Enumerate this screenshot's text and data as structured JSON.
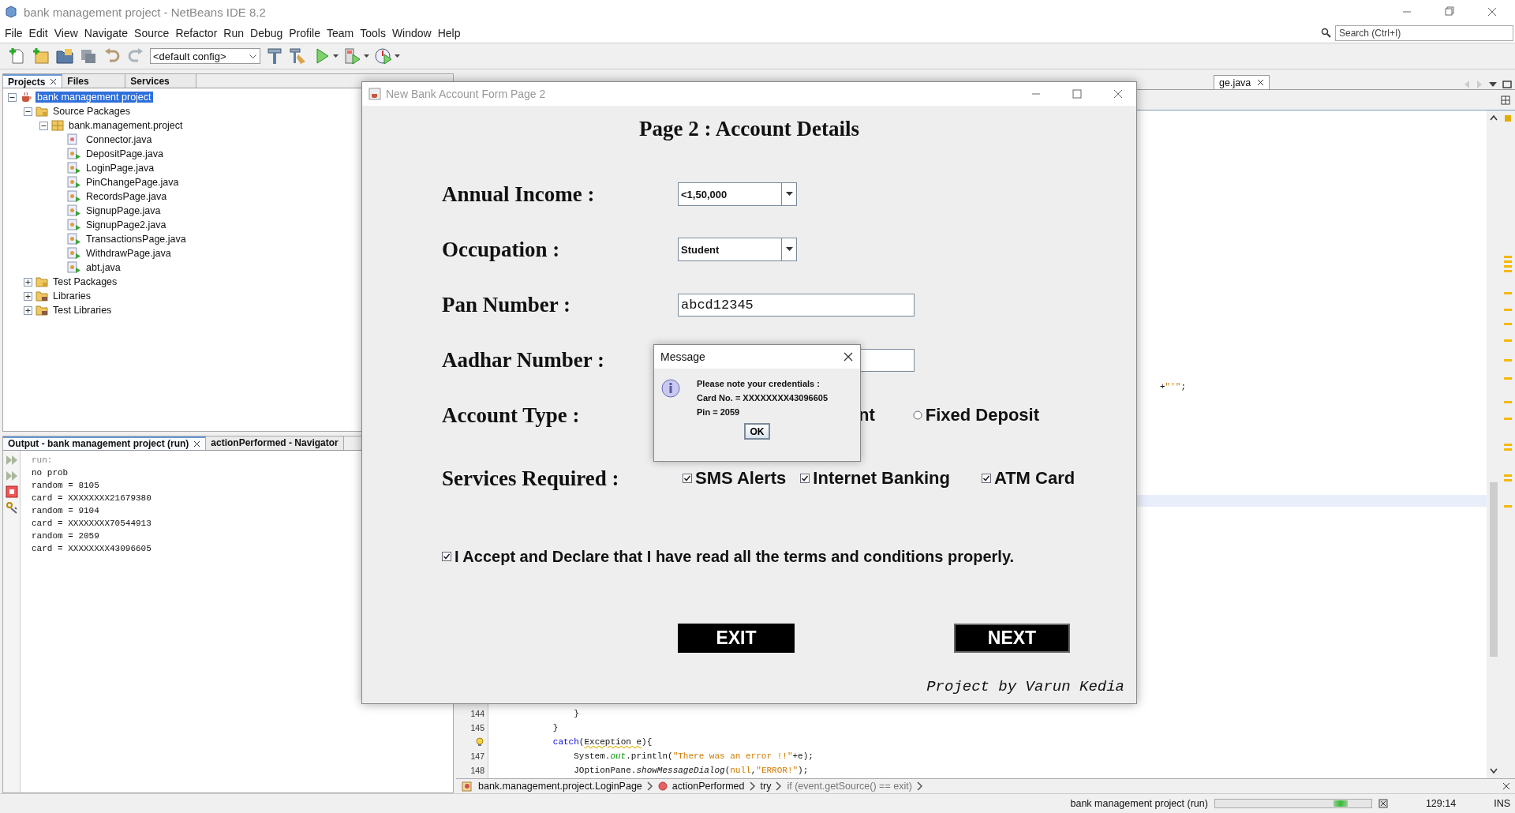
{
  "window": {
    "title": "bank management project - NetBeans IDE 8.2",
    "search_placeholder": "Search (Ctrl+I)"
  },
  "menu": [
    "File",
    "Edit",
    "View",
    "Navigate",
    "Source",
    "Refactor",
    "Run",
    "Debug",
    "Profile",
    "Team",
    "Tools",
    "Window",
    "Help"
  ],
  "toolbar": {
    "config": "<default config>"
  },
  "project_tabs": [
    {
      "label": "Projects",
      "selected": true
    },
    {
      "label": "Files",
      "selected": false
    },
    {
      "label": "Services",
      "selected": false
    }
  ],
  "project_tree": [
    {
      "label": "bank management project",
      "kind": "project",
      "selected": true,
      "expanded": true,
      "children": [
        {
          "label": "Source Packages",
          "kind": "folder",
          "selected": false,
          "expanded": true,
          "children": [
            {
              "label": "bank.management.project",
              "kind": "package",
              "selected": false,
              "expanded": true,
              "children": [
                {
                  "label": "Connector.java",
                  "kind": "file",
                  "selected": false,
                  "runnable": false
                },
                {
                  "label": "DepositPage.java",
                  "kind": "file",
                  "selected": false,
                  "runnable": true
                },
                {
                  "label": "LoginPage.java",
                  "kind": "file",
                  "selected": false,
                  "runnable": true
                },
                {
                  "label": "PinChangePage.java",
                  "kind": "file",
                  "selected": false,
                  "runnable": true
                },
                {
                  "label": "RecordsPage.java",
                  "kind": "file",
                  "selected": false,
                  "runnable": true
                },
                {
                  "label": "SignupPage.java",
                  "kind": "file",
                  "selected": false,
                  "runnable": true
                },
                {
                  "label": "SignupPage2.java",
                  "kind": "file",
                  "selected": false,
                  "runnable": true
                },
                {
                  "label": "TransactionsPage.java",
                  "kind": "file",
                  "selected": false,
                  "runnable": true
                },
                {
                  "label": "WithdrawPage.java",
                  "kind": "file",
                  "selected": false,
                  "runnable": true
                },
                {
                  "label": "abt.java",
                  "kind": "file",
                  "selected": false,
                  "runnable": true
                }
              ]
            }
          ]
        },
        {
          "label": "Test Packages",
          "kind": "folder",
          "selected": false,
          "expanded": false
        },
        {
          "label": "Libraries",
          "kind": "library",
          "selected": false,
          "expanded": false
        },
        {
          "label": "Test Libraries",
          "kind": "library",
          "selected": false,
          "expanded": false
        }
      ]
    }
  ],
  "output_tabs": [
    {
      "label": "Output - bank management project (run)",
      "selected": true
    },
    {
      "label": "actionPerformed - Navigator",
      "selected": false
    }
  ],
  "output_lines": [
    {
      "text": "run:",
      "kind": "meta"
    },
    {
      "text": "no prob",
      "kind": "plain"
    },
    {
      "text": "random = 8105",
      "kind": "plain"
    },
    {
      "text": "card = XXXXXXXX21679380",
      "kind": "plain"
    },
    {
      "text": "random = 9104",
      "kind": "plain"
    },
    {
      "text": "card = XXXXXXXX70544913",
      "kind": "plain"
    },
    {
      "text": "random = 2059",
      "kind": "plain"
    },
    {
      "text": "card = XXXXXXXX43096605",
      "kind": "plain"
    }
  ],
  "editor": {
    "tabs": [
      {
        "label": "ge.java",
        "selected": true
      }
    ],
    "fragment": [
      {
        "text": "+",
        "kind": "plain"
      },
      {
        "text": "\"'\"",
        "kind": "string"
      },
      {
        "text": ";",
        "kind": "plain"
      }
    ],
    "lines": [
      {
        "number": "144",
        "tokens": [
          {
            "text": "            }",
            "kind": "plain"
          }
        ]
      },
      {
        "number": "145",
        "tokens": [
          {
            "text": "        }",
            "kind": "plain"
          }
        ]
      },
      {
        "kind": "hint",
        "tokens": [
          {
            "text": "        catch",
            "kind": "keyword"
          },
          {
            "text": "(",
            "kind": "plain"
          },
          {
            "text": "Exception e",
            "kind": "warning"
          },
          {
            "text": "){",
            "kind": "plain"
          }
        ]
      },
      {
        "number": "147",
        "tokens": [
          {
            "text": "            System.",
            "kind": "plain"
          },
          {
            "text": "out",
            "kind": "field"
          },
          {
            "text": ".println(",
            "kind": "plain"
          },
          {
            "text": "\"There was an error !!\"",
            "kind": "string"
          },
          {
            "text": "+e);",
            "kind": "plain"
          }
        ]
      },
      {
        "number": "148",
        "tokens": [
          {
            "text": "            JOptionPane.",
            "kind": "plain"
          },
          {
            "text": "showMessageDialog",
            "kind": "static"
          },
          {
            "text": "(",
            "kind": "plain"
          },
          {
            "text": "null",
            "kind": "literal"
          },
          {
            "text": ",",
            "kind": "plain"
          },
          {
            "text": "\"ERROR!\"",
            "kind": "string"
          },
          {
            "text": ");",
            "kind": "plain"
          }
        ]
      }
    ]
  },
  "breadcrumbs": [
    {
      "label": "bank.management.project.LoginPage",
      "kind": "class"
    },
    {
      "label": "actionPerformed",
      "kind": "method"
    },
    {
      "label": "try",
      "kind": "plain"
    },
    {
      "label": "if (event.getSource() == exit)",
      "kind": "condition"
    }
  ],
  "status": {
    "task": "bank management project (run)",
    "position": "129:14",
    "mode": "INS"
  },
  "form": {
    "title": "New Bank Account Form Page 2",
    "heading": "Page 2 : Account Details",
    "fields": [
      {
        "label": "Annual Income :",
        "kind": "dropdown",
        "value": "<1,50,000"
      },
      {
        "label": "Occupation :",
        "kind": "dropdown",
        "value": "Student"
      },
      {
        "label": "Pan Number :",
        "kind": "text",
        "value": "abcd12345"
      },
      {
        "label": "Aadhar Number :",
        "kind": "text"
      },
      {
        "label": "Account Type :",
        "kind": "radios",
        "options": [
          {
            "label": "nt"
          },
          {
            "label": "Fixed Deposit",
            "selected": false
          }
        ]
      },
      {
        "label": "Services Required :",
        "kind": "checkboxes",
        "options": [
          {
            "label": "SMS Alerts",
            "checked": true
          },
          {
            "label": "Internet Banking",
            "checked": true
          },
          {
            "label": "ATM Card",
            "checked": true
          }
        ]
      }
    ],
    "declaration": {
      "text": "I Accept and Declare that I have read all the terms and conditions properly.",
      "checked": true
    },
    "buttons": [
      {
        "label": "EXIT",
        "focused": false
      },
      {
        "label": "NEXT",
        "focused": true
      }
    ],
    "credit": "Project by Varun Kedia"
  },
  "dialog": {
    "title": "Message",
    "lines": [
      "Please note your credentials :",
      "Card No. = XXXXXXXX43096605",
      "Pin = 2059"
    ],
    "button": "OK"
  }
}
